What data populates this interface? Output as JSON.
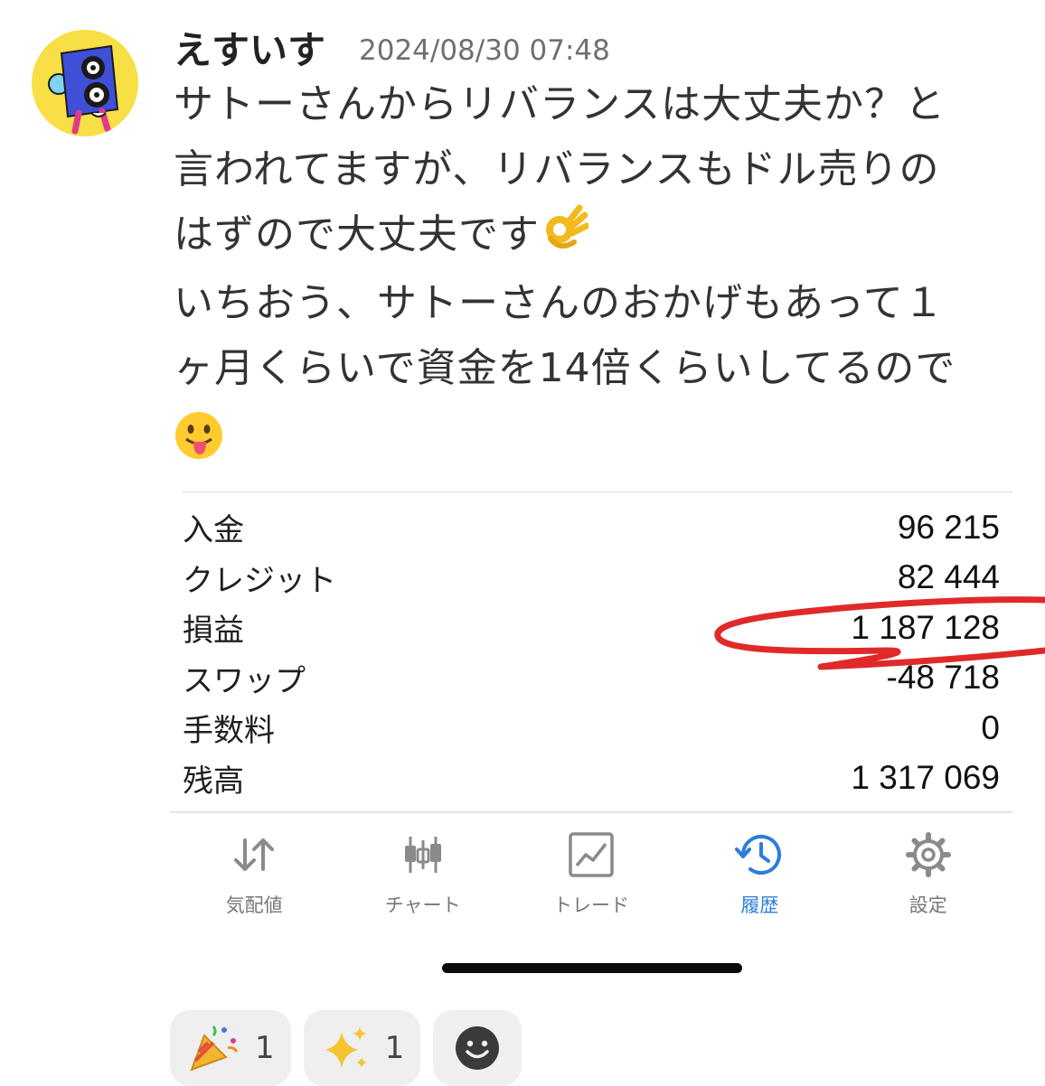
{
  "post": {
    "author": "えすいす",
    "timestamp": "2024/08/30 07:48",
    "message_lines": [
      "サトーさんからリバランスは大丈夫か？と",
      "言われてますが、リバランスもドル売りの",
      "はずので大丈夫です",
      "いちおう、サトーさんのおかげもあって１",
      "ヶ月くらいで資金を14倍くらいしてるので"
    ],
    "emojis": [
      "ok-hand",
      "tongue-face"
    ]
  },
  "screenshot": {
    "rows": [
      {
        "label": "入金",
        "value": "96 215"
      },
      {
        "label": "クレジット",
        "value": "82 444"
      },
      {
        "label": "損益",
        "value": "1 187 128"
      },
      {
        "label": "スワップ",
        "value": "-48 718"
      },
      {
        "label": "手数料",
        "value": "0"
      },
      {
        "label": "残高",
        "value": "1 317 069"
      }
    ],
    "tabs": [
      {
        "label": "気配値",
        "icon": "quotes-arrows-icon"
      },
      {
        "label": "チャート",
        "icon": "candlestick-icon"
      },
      {
        "label": "トレード",
        "icon": "trade-chart-icon"
      },
      {
        "label": "履歴",
        "icon": "history-icon",
        "active": true
      },
      {
        "label": "設定",
        "icon": "gear-icon"
      }
    ],
    "active_color": "#2d7ddb",
    "highlight_color": "#e02a2a"
  },
  "reactions": [
    {
      "icon": "party-popper-icon",
      "count": "1"
    },
    {
      "icon": "sparkles-icon",
      "count": "1"
    },
    {
      "icon": "add-reaction-smiley-icon"
    }
  ]
}
